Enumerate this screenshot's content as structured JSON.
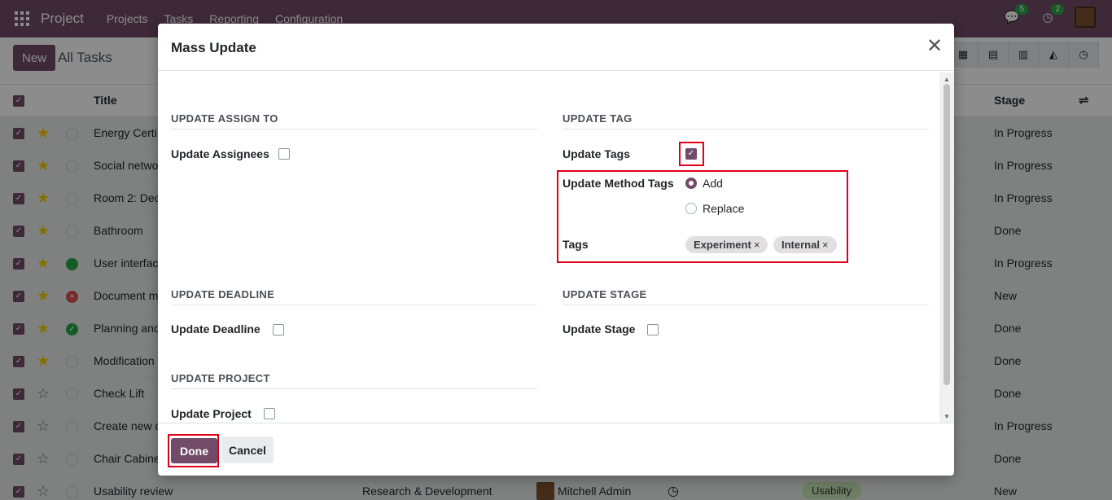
{
  "navbar": {
    "brand": "Project",
    "menu": [
      "Projects",
      "Tasks",
      "Reporting",
      "Configuration"
    ],
    "messages_count": "5",
    "activities_count": "2"
  },
  "control_panel": {
    "new_label": "New",
    "title": "All Tasks"
  },
  "list": {
    "col_title": "Title",
    "col_stage": "Stage",
    "rows": [
      {
        "title": "Energy Certi",
        "stage": "In Progress"
      },
      {
        "title": "Social netwo",
        "stage": "In Progress"
      },
      {
        "title": "Room 2: Dec",
        "stage": "In Progress"
      },
      {
        "title": "Bathroom",
        "stage": "Done"
      },
      {
        "title": "User interfac",
        "stage": "In Progress"
      },
      {
        "title": "Document m",
        "stage": "New"
      },
      {
        "title": "Planning and",
        "stage": "Done"
      },
      {
        "title": "Modification",
        "stage": "Done"
      },
      {
        "title": "Check Lift",
        "stage": "Done"
      },
      {
        "title": "Create new c",
        "stage": "In Progress"
      },
      {
        "title": "Chair Cabine",
        "stage": "Done"
      },
      {
        "title": "Usability review",
        "stage": "New",
        "project": "Research & Development",
        "assignee": "Mitchell Admin",
        "tag": "Usability"
      }
    ]
  },
  "modal": {
    "title": "Mass Update",
    "sections": {
      "assign": "UPDATE ASSIGN TO",
      "tag": "UPDATE TAG",
      "deadline": "UPDATE DEADLINE",
      "stage": "UPDATE STAGE",
      "project": "UPDATE PROJECT"
    },
    "fields": {
      "assignees": "Update Assignees",
      "tags": "Update Tags",
      "method_tags": "Update Method Tags",
      "tags_label": "Tags",
      "deadline": "Update Deadline",
      "stage": "Update Stage",
      "project": "Update Project"
    },
    "method_options": {
      "add": "Add",
      "replace": "Replace"
    },
    "tag_values": [
      "Experiment",
      "Internal"
    ],
    "done_label": "Done",
    "cancel_label": "Cancel"
  }
}
